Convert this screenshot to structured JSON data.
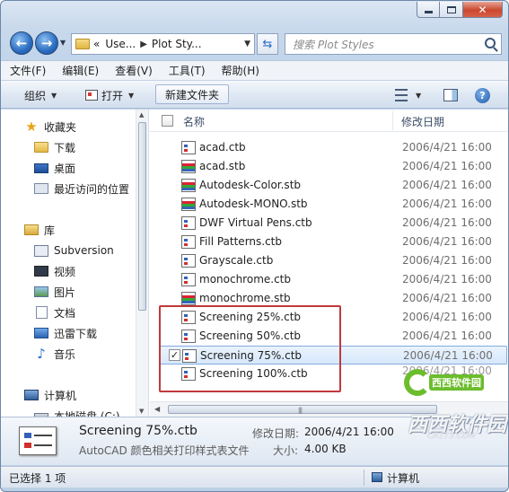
{
  "address": {
    "history_glyph": "«",
    "crumbs": [
      "Use...",
      "Plot Sty..."
    ]
  },
  "search": {
    "placeholder": "搜索 Plot Styles"
  },
  "menu": [
    "文件(F)",
    "编辑(E)",
    "查看(V)",
    "工具(T)",
    "帮助(H)"
  ],
  "commands": {
    "organize": "组织",
    "open": "打开",
    "new_folder": "新建文件夹"
  },
  "nav_pane": {
    "favorites": "收藏夹",
    "downloads": "下载",
    "desktop": "桌面",
    "recent": "最近访问的位置",
    "libraries": "库",
    "subversion": "Subversion",
    "videos": "视频",
    "pictures": "图片",
    "documents": "文档",
    "thunder": "迅雷下载",
    "music": "音乐",
    "computer": "计算机",
    "local_disk": "本地磁盘 (C:)"
  },
  "columns": {
    "name": "名称",
    "date": "修改日期"
  },
  "files": [
    {
      "name": "acad.ctb",
      "date": "2006/4/21 16:00",
      "type": "ctb"
    },
    {
      "name": "acad.stb",
      "date": "2006/4/21 16:00",
      "type": "stb"
    },
    {
      "name": "Autodesk-Color.stb",
      "date": "2006/4/21 16:00",
      "type": "stb"
    },
    {
      "name": "Autodesk-MONO.stb",
      "date": "2006/4/21 16:00",
      "type": "stb"
    },
    {
      "name": "DWF Virtual Pens.ctb",
      "date": "2006/4/21 16:00",
      "type": "ctb"
    },
    {
      "name": "Fill Patterns.ctb",
      "date": "2006/4/21 16:00",
      "type": "ctb"
    },
    {
      "name": "Grayscale.ctb",
      "date": "2006/4/21 16:00",
      "type": "ctb"
    },
    {
      "name": "monochrome.ctb",
      "date": "2006/4/21 16:00",
      "type": "ctb"
    },
    {
      "name": "monochrome.stb",
      "date": "2006/4/21 16:00",
      "type": "stb"
    },
    {
      "name": "Screening 25%.ctb",
      "date": "2006/4/21 16:00",
      "type": "ctb"
    },
    {
      "name": "Screening 50%.ctb",
      "date": "2006/4/21 16:00",
      "type": "ctb"
    },
    {
      "name": "Screening 75%.ctb",
      "date": "2006/4/21 16:00",
      "type": "ctb",
      "selected": true
    },
    {
      "name": "Screening 100%.ctb",
      "date": "",
      "type": "ctb"
    }
  ],
  "partial_date": "2006/4/21 16:00",
  "details": {
    "name": "Screening 75%.ctb",
    "type_desc": "AutoCAD 颜色相关打印样式表文件",
    "modified_label": "修改日期:",
    "modified_value": "2006/4/21 16:00",
    "size_label": "大小:",
    "size_value": "4.00 KB"
  },
  "watermark": {
    "chip": "西西软件园",
    "big": "西西软件园",
    "small": "CR173.COM"
  },
  "status": {
    "selected": "已选择 1 项",
    "location": "计算机"
  },
  "colors": {
    "highlight": "#c0393b",
    "selection": "#d6e8fb",
    "accent_blue": "#2a6cc0"
  }
}
